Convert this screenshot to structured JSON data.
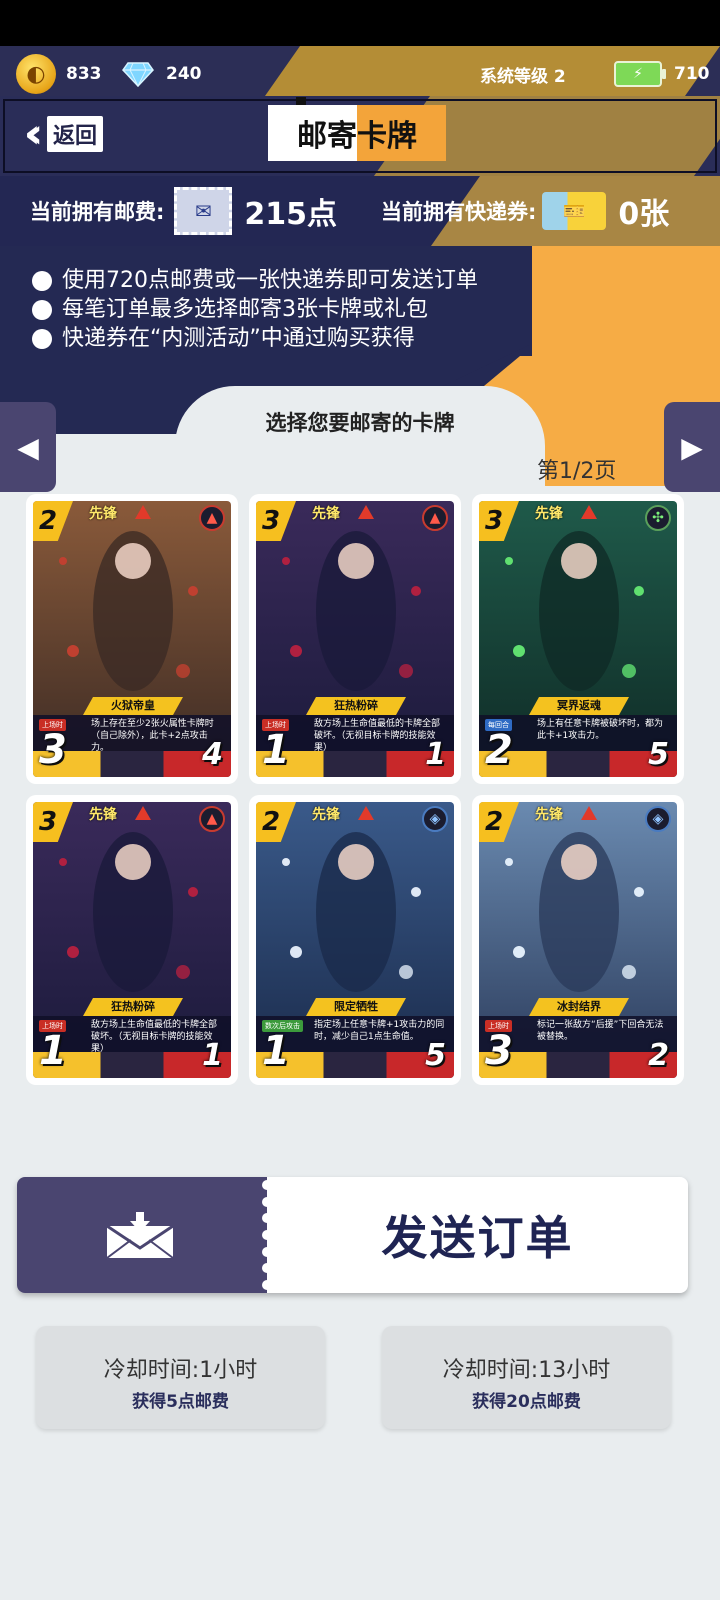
{
  "status": {
    "coins": "833",
    "diamonds": "240",
    "system_level": "系统等级 2",
    "energy": "710"
  },
  "header": {
    "back_label": "返回",
    "title": "邮寄卡牌"
  },
  "fees": {
    "postage_label": "当前拥有邮费:",
    "postage_value": "215点",
    "express_label": "当前拥有快递券:",
    "express_value": "0张"
  },
  "notes": [
    "使用720点邮费或一张快递券即可发送订单",
    "每笔订单最多选择邮寄3张卡牌或礼包",
    "快递券在“内测活动”中通过购买获得"
  ],
  "select_title": "选择您要邮寄的卡牌",
  "page_indicator": "第1/2页",
  "cards": [
    {
      "cost": "2",
      "role": "先锋",
      "skill": "火狱帝皇",
      "tag": "上场时",
      "desc": "场上存在至少2张火属性卡牌时（自己除外），此卡+2点攻击力。",
      "atk": "3",
      "hp": "4",
      "element": "fire",
      "colors": [
        "#3a2a24",
        "#8a5a3a",
        "#c04030"
      ]
    },
    {
      "cost": "3",
      "role": "先锋",
      "skill": "狂热粉碎",
      "tag": "上场时",
      "desc": "敌方场上生命值最低的卡牌全部破坏。（无视目标卡牌的技能效果）",
      "atk": "1",
      "hp": "1",
      "element": "fire",
      "colors": [
        "#1a1a3a",
        "#3a2a5a",
        "#b02040"
      ]
    },
    {
      "cost": "3",
      "role": "先锋",
      "skill": "冥界返魂",
      "tag": "每回合",
      "desc": "场上有任意卡牌被破坏时，都为此卡+1攻击力。",
      "atk": "2",
      "hp": "5",
      "element": "wind",
      "colors": [
        "#0f2a25",
        "#1f5a4a",
        "#60e070"
      ]
    },
    {
      "cost": "3",
      "role": "先锋",
      "skill": "狂热粉碎",
      "tag": "上场时",
      "desc": "敌方场上生命值最低的卡牌全部破坏。（无视目标卡牌的技能效果）",
      "atk": "1",
      "hp": "1",
      "element": "fire",
      "colors": [
        "#1a1a3a",
        "#3a2a5a",
        "#b02040"
      ]
    },
    {
      "cost": "2",
      "role": "先锋",
      "skill": "限定牺牲",
      "tag": "数次后攻击",
      "desc": "指定场上任意卡牌+1攻击力的同时，减少自己1点生命值。",
      "atk": "1",
      "hp": "5",
      "element": "water",
      "colors": [
        "#1a2a4a",
        "#3a5a8a",
        "#dfe8f5"
      ]
    },
    {
      "cost": "2",
      "role": "先锋",
      "skill": "冰封结界",
      "tag": "上场时",
      "desc": "标记一张敌方“后援”下回合无法被替换。",
      "atk": "3",
      "hp": "2",
      "element": "water",
      "colors": [
        "#2a3a5a",
        "#6a8ab0",
        "#e0ecf8"
      ]
    }
  ],
  "send_button": "发送订单",
  "cooldowns": [
    {
      "time": "冷却时间:1小时",
      "reward": "获得5点邮费"
    },
    {
      "time": "冷却时间:13小时",
      "reward": "获得20点邮费"
    }
  ],
  "icons": {
    "coin": "coin-icon",
    "diamond": "diamond-icon",
    "battery": "battery-icon",
    "envelope": "envelope-icon"
  },
  "colors": {
    "navy": "#242953",
    "gold": "#b48d36",
    "orange": "#f6ac45",
    "button_purple": "#4a4570"
  }
}
